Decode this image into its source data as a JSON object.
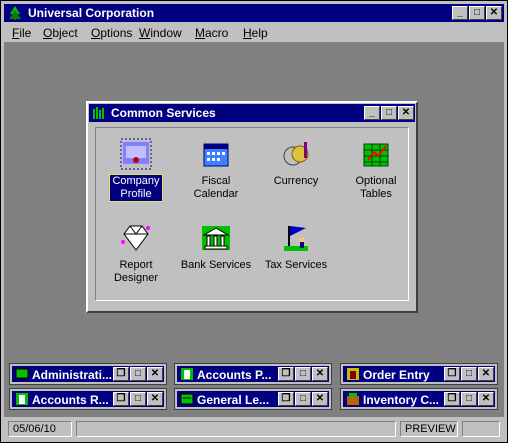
{
  "app": {
    "title": "Universal Corporation"
  },
  "menu": [
    "File",
    "Object",
    "Options",
    "Window",
    "Macro",
    "Help"
  ],
  "menu_mnemonics": [
    "F",
    "O",
    "O",
    "W",
    "M",
    "H"
  ],
  "child_window": {
    "title": "Common Services",
    "icons": [
      {
        "label1": "Company",
        "label2": "Profile",
        "icon": "company-profile-icon",
        "selected": true
      },
      {
        "label1": "Fiscal",
        "label2": "Calendar",
        "icon": "calendar-icon"
      },
      {
        "label1": "Currency",
        "label2": "",
        "icon": "coins-icon"
      },
      {
        "label1": "Optional",
        "label2": "Tables",
        "icon": "tables-icon"
      },
      {
        "label1": "Report",
        "label2": "Designer",
        "icon": "diamond-icon"
      },
      {
        "label1": "Bank Services",
        "label2": "",
        "icon": "bank-icon"
      },
      {
        "label1": "Tax Services",
        "label2": "",
        "icon": "flag-icon"
      }
    ]
  },
  "minimized": [
    {
      "title": "Administrati..."
    },
    {
      "title": "Accounts P..."
    },
    {
      "title": "Order Entry"
    },
    {
      "title": "Accounts R..."
    },
    {
      "title": "General Le..."
    },
    {
      "title": "Inventory C..."
    }
  ],
  "status": {
    "date": "05/06/10",
    "mode": "PREVIEW"
  },
  "colors": {
    "titlebar": "#000080",
    "face": "#c0c0c0",
    "workspace": "#808080"
  }
}
